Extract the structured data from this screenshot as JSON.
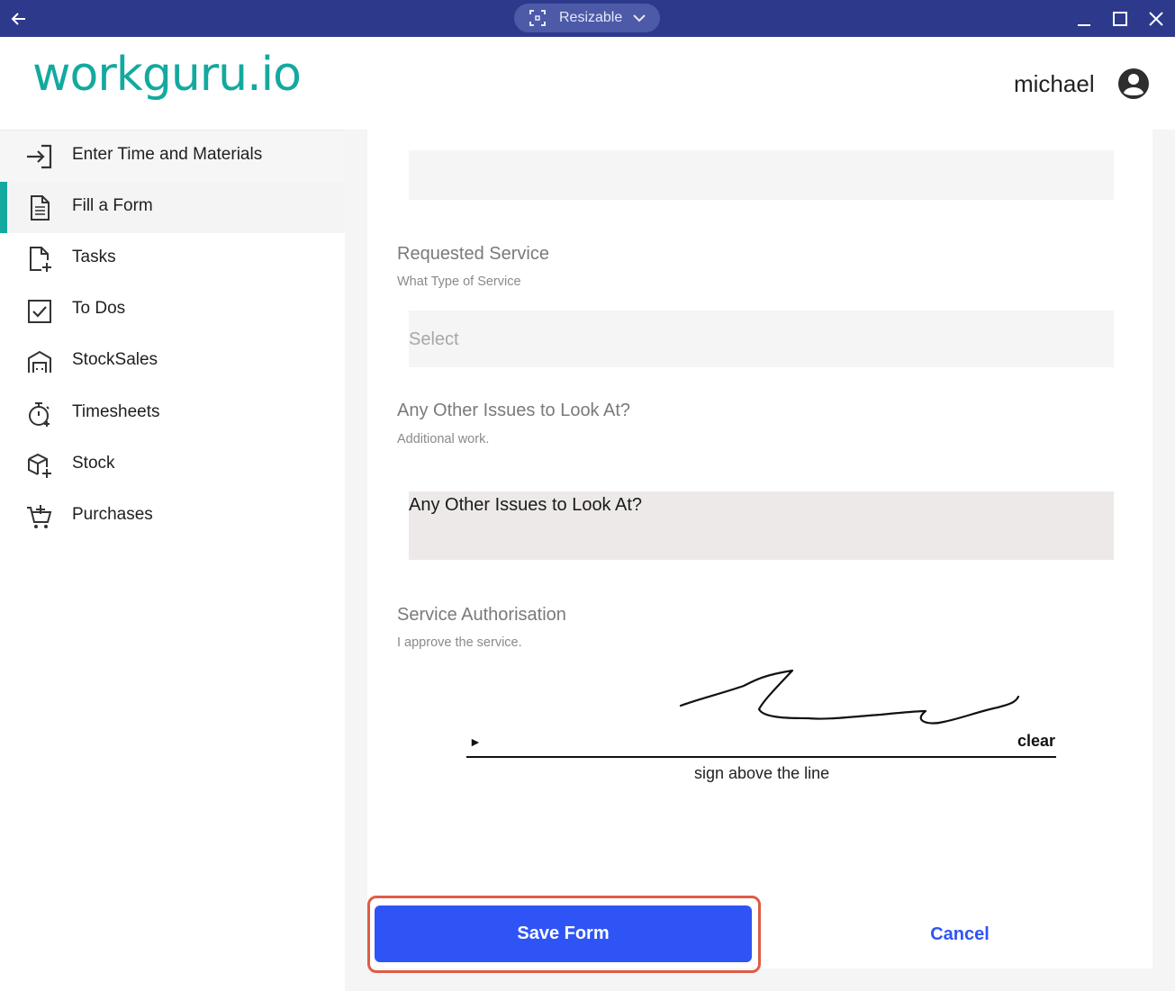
{
  "titlebar": {
    "window_mode": "Resizable",
    "back_icon": "arrow-left-icon",
    "minimize_icon": "minimize-icon",
    "maximize_icon": "maximize-icon",
    "close_icon": "close-icon",
    "background_color": "#2d3a8c"
  },
  "header": {
    "logo_text": "workguru.io",
    "logo_color": "#14a99e",
    "username": "michael",
    "avatar_icon": "account-circle-icon"
  },
  "sidebar": {
    "active_color": "#14a99e",
    "items": [
      {
        "label": "Enter Time and Materials",
        "icon": "login-arrow-icon"
      },
      {
        "label": "Fill a Form",
        "icon": "document-icon",
        "active": true
      },
      {
        "label": "Tasks",
        "icon": "file-add-icon"
      },
      {
        "label": "To Dos",
        "icon": "checkbox-icon"
      },
      {
        "label": "StockSales",
        "icon": "warehouse-icon"
      },
      {
        "label": "Timesheets",
        "icon": "stopwatch-icon"
      },
      {
        "label": "Stock",
        "icon": "box-add-icon"
      },
      {
        "label": "Purchases",
        "icon": "cart-add-icon"
      }
    ]
  },
  "form": {
    "requested_service": {
      "title": "Requested Service",
      "subtitle": "What Type of Service",
      "placeholder": "Select"
    },
    "other_issues": {
      "title": "Any Other Issues to Look At?",
      "subtitle": "Additional work.",
      "value": "Any Other Issues to Look At?"
    },
    "authorisation": {
      "title": "Service Authorisation",
      "subtitle": "I approve the service.",
      "marker": "►",
      "clear_label": "clear",
      "caption": "sign above the line"
    },
    "save_label": "Save Form",
    "cancel_label": "Cancel",
    "save_color": "#2f54f5"
  }
}
